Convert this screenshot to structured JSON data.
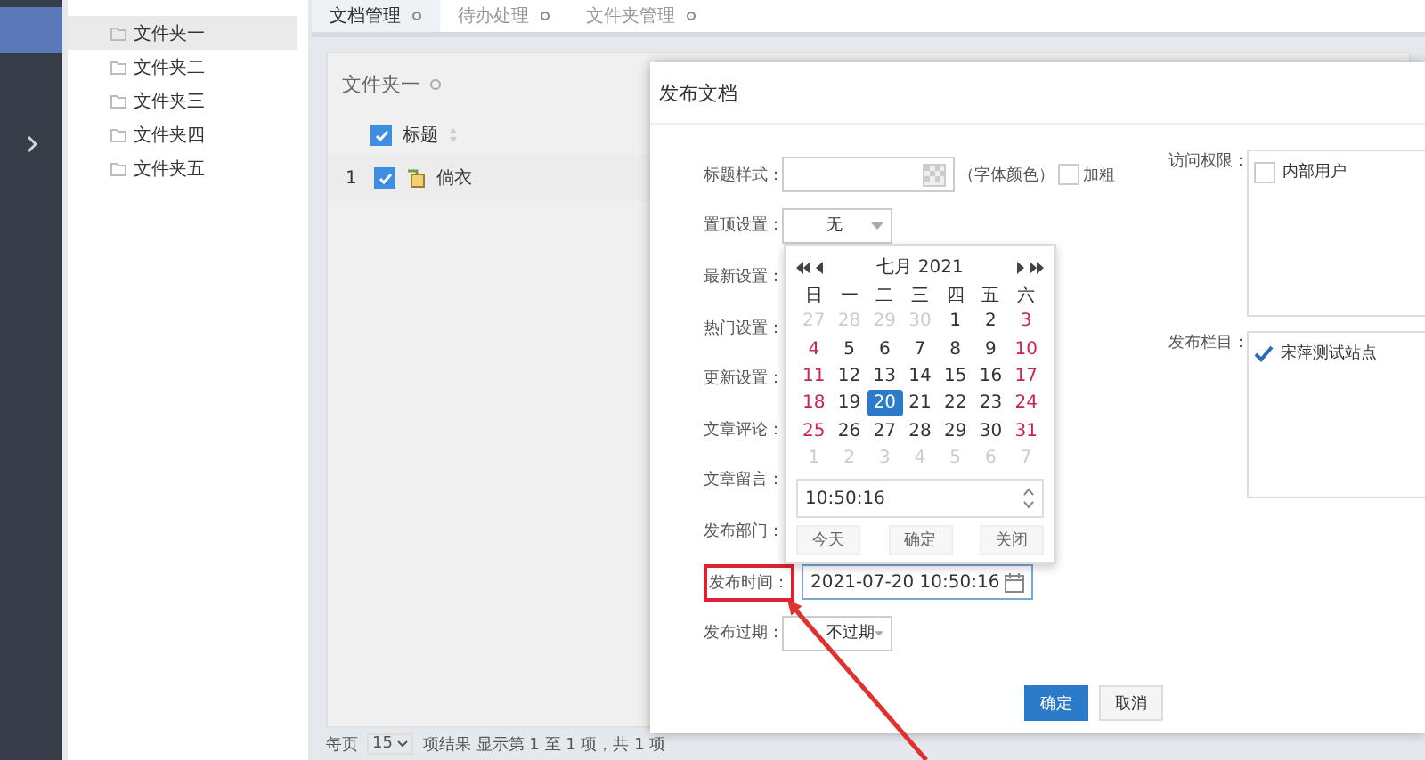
{
  "nav": {
    "items": [
      {
        "selected": true
      },
      {
        "selected": false
      }
    ]
  },
  "tree": {
    "items": [
      {
        "label": "文件夹一",
        "selected": true
      },
      {
        "label": "文件夹二",
        "selected": false
      },
      {
        "label": "文件夹三",
        "selected": false
      },
      {
        "label": "文件夹四",
        "selected": false
      },
      {
        "label": "文件夹五",
        "selected": false
      }
    ]
  },
  "tabs": [
    {
      "label": "文档管理",
      "selected": true
    },
    {
      "label": "待办处理",
      "selected": false
    },
    {
      "label": "文件夹管理",
      "selected": false
    }
  ],
  "panel": {
    "title": "文件夹一",
    "table": {
      "header": {
        "checked": true,
        "label": "标题"
      },
      "rows": [
        {
          "index": "1",
          "checked": true,
          "title": "倘衣"
        }
      ]
    },
    "pager": {
      "per_page_label": "每页",
      "per_page": "15",
      "summary": "项结果 显示第 1 至 1 项，共 1 项"
    }
  },
  "dialog": {
    "title": "发布文档",
    "fields": [
      {
        "kind": "style",
        "label": "标题样式：",
        "note": "（字体颜色）",
        "bold_label": "加粗",
        "bold_checked": false
      },
      {
        "kind": "select",
        "label": "置顶设置：",
        "value": "无"
      },
      {
        "kind": "hidden",
        "label": "最新设置："
      },
      {
        "kind": "hidden",
        "label": "热门设置："
      },
      {
        "kind": "hidden",
        "label": "更新设置："
      },
      {
        "kind": "hidden",
        "label": "文章评论："
      },
      {
        "kind": "hidden",
        "label": "文章留言："
      },
      {
        "kind": "hidden",
        "label": "发布部门："
      },
      {
        "kind": "date",
        "label": "发布时间：",
        "value": "2021-07-20 10:50:16",
        "highlighted": true
      },
      {
        "kind": "select",
        "label": "发布过期：",
        "value": "不过期"
      }
    ],
    "side_fields": [
      {
        "label": "访问权限：",
        "options": [
          {
            "label": "内部用户",
            "checked": false
          }
        ]
      },
      {
        "label": "发布栏目：",
        "options": [
          {
            "label": "宋萍测试站点",
            "checked": true
          }
        ]
      }
    ],
    "buttons": [
      {
        "label": "确定",
        "kind": "primary"
      },
      {
        "label": "取消",
        "kind": "default"
      }
    ]
  },
  "calendar": {
    "title": "七月 2021",
    "weekdays": [
      "日",
      "一",
      "二",
      "三",
      "四",
      "五",
      "六"
    ],
    "weeks": [
      [
        {
          "label": "27",
          "muted": true,
          "selected": false
        },
        {
          "label": "28",
          "muted": true,
          "selected": false
        },
        {
          "label": "29",
          "muted": true,
          "selected": false
        },
        {
          "label": "30",
          "muted": true,
          "selected": false
        },
        {
          "label": "1",
          "muted": false,
          "selected": false
        },
        {
          "label": "2",
          "muted": false,
          "selected": false
        },
        {
          "label": "3",
          "muted": false,
          "selected": false
        }
      ],
      [
        {
          "label": "4",
          "muted": false,
          "selected": false
        },
        {
          "label": "5",
          "muted": false,
          "selected": false
        },
        {
          "label": "6",
          "muted": false,
          "selected": false
        },
        {
          "label": "7",
          "muted": false,
          "selected": false
        },
        {
          "label": "8",
          "muted": false,
          "selected": false
        },
        {
          "label": "9",
          "muted": false,
          "selected": false
        },
        {
          "label": "10",
          "muted": false,
          "selected": false
        }
      ],
      [
        {
          "label": "11",
          "muted": false,
          "selected": false
        },
        {
          "label": "12",
          "muted": false,
          "selected": false
        },
        {
          "label": "13",
          "muted": false,
          "selected": false
        },
        {
          "label": "14",
          "muted": false,
          "selected": false
        },
        {
          "label": "15",
          "muted": false,
          "selected": false
        },
        {
          "label": "16",
          "muted": false,
          "selected": false
        },
        {
          "label": "17",
          "muted": false,
          "selected": false
        }
      ],
      [
        {
          "label": "18",
          "muted": false,
          "selected": false
        },
        {
          "label": "19",
          "muted": false,
          "selected": false
        },
        {
          "label": "20",
          "muted": false,
          "selected": true
        },
        {
          "label": "21",
          "muted": false,
          "selected": false
        },
        {
          "label": "22",
          "muted": false,
          "selected": false
        },
        {
          "label": "23",
          "muted": false,
          "selected": false
        },
        {
          "label": "24",
          "muted": false,
          "selected": false
        }
      ],
      [
        {
          "label": "25",
          "muted": false,
          "selected": false
        },
        {
          "label": "26",
          "muted": false,
          "selected": false
        },
        {
          "label": "27",
          "muted": false,
          "selected": false
        },
        {
          "label": "28",
          "muted": false,
          "selected": false
        },
        {
          "label": "29",
          "muted": false,
          "selected": false
        },
        {
          "label": "30",
          "muted": false,
          "selected": false
        },
        {
          "label": "31",
          "muted": false,
          "selected": false
        }
      ],
      [
        {
          "label": "1",
          "muted": true,
          "selected": false
        },
        {
          "label": "2",
          "muted": true,
          "selected": false
        },
        {
          "label": "3",
          "muted": true,
          "selected": false
        },
        {
          "label": "4",
          "muted": true,
          "selected": false
        },
        {
          "label": "5",
          "muted": true,
          "selected": false
        },
        {
          "label": "6",
          "muted": true,
          "selected": false
        },
        {
          "label": "7",
          "muted": true,
          "selected": false
        }
      ]
    ],
    "time": "10:50:16",
    "buttons": [
      "今天",
      "确定",
      "关闭"
    ]
  }
}
